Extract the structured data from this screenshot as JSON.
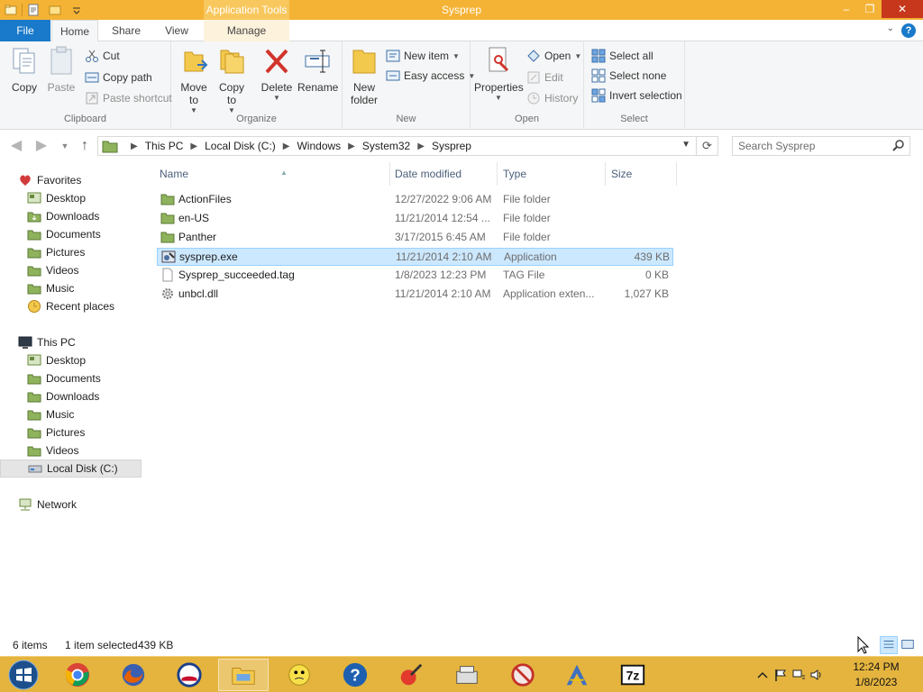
{
  "window": {
    "title": "Sysprep",
    "context_tab_header": "Application Tools",
    "controls": {
      "minimize": "–",
      "maximize": "❐",
      "close": "✕"
    }
  },
  "tabs": {
    "file": "File",
    "home": "Home",
    "share": "Share",
    "view": "View",
    "manage": "Manage",
    "help": "?"
  },
  "ribbon": {
    "clipboard": {
      "label": "Clipboard",
      "copy": "Copy",
      "paste": "Paste",
      "cut": "Cut",
      "copy_path": "Copy path",
      "paste_shortcut": "Paste shortcut"
    },
    "organize": {
      "label": "Organize",
      "move_to": "Move to",
      "copy_to": "Copy to",
      "delete": "Delete",
      "rename": "Rename"
    },
    "new": {
      "label": "New",
      "new_folder": "New folder",
      "new_item": "New item",
      "easy_access": "Easy access"
    },
    "open": {
      "label": "Open",
      "properties": "Properties",
      "open": "Open",
      "edit": "Edit",
      "history": "History"
    },
    "select": {
      "label": "Select",
      "select_all": "Select all",
      "select_none": "Select none",
      "invert_selection": "Invert selection"
    }
  },
  "address": {
    "crumbs": [
      "This PC",
      "Local Disk (C:)",
      "Windows",
      "System32",
      "Sysprep"
    ],
    "search_placeholder": "Search Sysprep"
  },
  "nav": {
    "favorites": "Favorites",
    "favorites_items": [
      "Desktop",
      "Downloads",
      "Documents",
      "Pictures",
      "Videos",
      "Music",
      "Recent places"
    ],
    "this_pc": "This PC",
    "this_pc_items": [
      "Desktop",
      "Documents",
      "Downloads",
      "Music",
      "Pictures",
      "Videos",
      "Local Disk (C:)"
    ],
    "network": "Network"
  },
  "columns": {
    "name": "Name",
    "date": "Date modified",
    "type": "Type",
    "size": "Size"
  },
  "files": [
    {
      "name": "ActionFiles",
      "date": "12/27/2022 9:06 AM",
      "type": "File folder",
      "size": "",
      "icon": "folder-icon"
    },
    {
      "name": "en-US",
      "date": "11/21/2014 12:54 ...",
      "type": "File folder",
      "size": "",
      "icon": "folder-icon"
    },
    {
      "name": "Panther",
      "date": "3/17/2015 6:45 AM",
      "type": "File folder",
      "size": "",
      "icon": "folder-icon"
    },
    {
      "name": "sysprep.exe",
      "date": "11/21/2014 2:10 AM",
      "type": "Application",
      "size": "439 KB",
      "icon": "application-icon",
      "selected": true
    },
    {
      "name": "Sysprep_succeeded.tag",
      "date": "1/8/2023 12:23 PM",
      "type": "TAG File",
      "size": "0 KB",
      "icon": "document-icon"
    },
    {
      "name": "unbcl.dll",
      "date": "11/21/2014 2:10 AM",
      "type": "Application exten...",
      "size": "1,027 KB",
      "icon": "dll-gear-icon"
    }
  ],
  "status": {
    "item_count": "6 items",
    "selection": "1 item selected",
    "selection_size": "439 KB"
  },
  "taskbar": {
    "apps": [
      "chrome-icon",
      "firefox-icon",
      "obama-logo-icon",
      "file-explorer-icon",
      "smiley-icon",
      "help-icon",
      "paint-icon",
      "register-icon",
      "no-sign-icon",
      "arch-icon",
      "7zip-icon"
    ],
    "sevenzip_label": "7z",
    "help_label": "?",
    "time": "12:24 PM",
    "date": "1/8/2023"
  },
  "colors": {
    "title_bar": "#f5b335",
    "accent": "#1979ca",
    "selection": "#cce8ff",
    "taskbar": "#e4b43f",
    "folder": "#e8c466"
  }
}
